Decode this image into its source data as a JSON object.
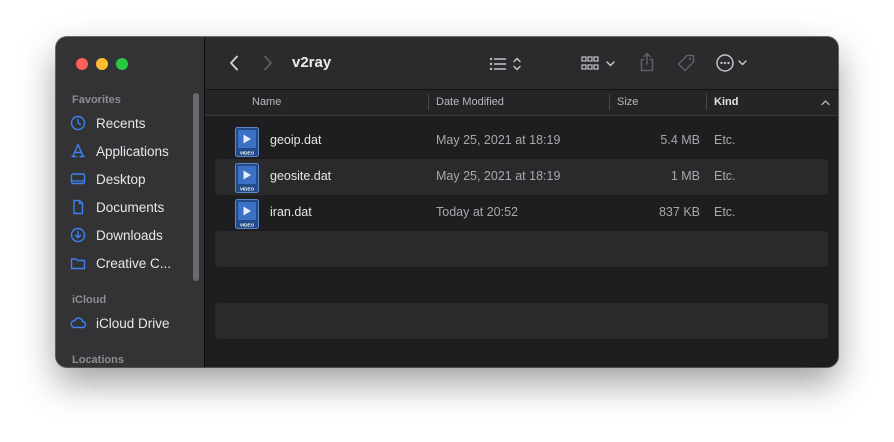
{
  "sidebar": {
    "favorites_title": "Favorites",
    "favorites": [
      {
        "label": "Recents",
        "icon": "clock-icon"
      },
      {
        "label": "Applications",
        "icon": "applications-icon"
      },
      {
        "label": "Desktop",
        "icon": "desktop-icon"
      },
      {
        "label": "Documents",
        "icon": "document-icon"
      },
      {
        "label": "Downloads",
        "icon": "download-icon"
      },
      {
        "label": "Creative C...",
        "icon": "folder-icon"
      }
    ],
    "icloud_title": "iCloud",
    "icloud": [
      {
        "label": "iCloud Drive",
        "icon": "cloud-icon"
      }
    ],
    "locations_title": "Locations"
  },
  "toolbar": {
    "title": "v2ray"
  },
  "columns": {
    "name": "Name",
    "date": "Date Modified",
    "size": "Size",
    "kind": "Kind"
  },
  "files": [
    {
      "name": "geoip.dat",
      "date": "May 25, 2021 at 18:19",
      "size": "5.4 MB",
      "kind": "Etc."
    },
    {
      "name": "geosite.dat",
      "date": "May 25, 2021 at 18:19",
      "size": "1 MB",
      "kind": "Etc."
    },
    {
      "name": "iran.dat",
      "date": "Today at 20:52",
      "size": "837 KB",
      "kind": "Etc."
    }
  ],
  "file_icon_badge": "VIDEO",
  "colors": {
    "accent": "#3b82f6",
    "close": "#ff5f57",
    "minimize": "#febc2e",
    "zoom": "#28c840"
  }
}
